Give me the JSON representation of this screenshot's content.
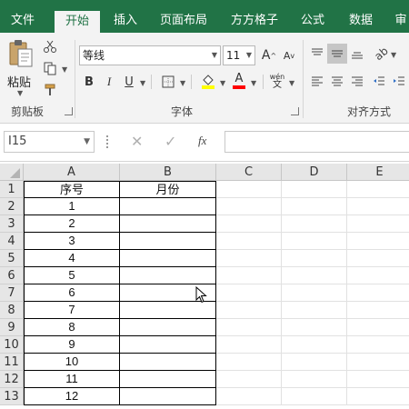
{
  "ribbon_tabs": [
    "文件",
    "开始",
    "插入",
    "页面布局",
    "方方格子",
    "公式",
    "数据",
    "审"
  ],
  "clipboard": {
    "paste_label": "粘贴",
    "group_label": "剪贴板"
  },
  "font": {
    "name": "等线",
    "size": "11",
    "group_label": "字体",
    "bold": "B",
    "italic": "I",
    "underline": "U",
    "grow": "A",
    "shrink": "A",
    "font_color_letter": "A",
    "phonetic": "wén"
  },
  "alignment": {
    "group_label": "对齐方式"
  },
  "formula_bar": {
    "name_box": "I15",
    "fx": "fx",
    "value": ""
  },
  "columns": [
    "A",
    "B",
    "C",
    "D",
    "E"
  ],
  "rows": [
    {
      "n": "1",
      "a": "序号",
      "b": "月份"
    },
    {
      "n": "2",
      "a": "1",
      "b": ""
    },
    {
      "n": "3",
      "a": "2",
      "b": ""
    },
    {
      "n": "4",
      "a": "3",
      "b": ""
    },
    {
      "n": "5",
      "a": "4",
      "b": ""
    },
    {
      "n": "6",
      "a": "5",
      "b": ""
    },
    {
      "n": "7",
      "a": "6",
      "b": ""
    },
    {
      "n": "8",
      "a": "7",
      "b": ""
    },
    {
      "n": "9",
      "a": "8",
      "b": ""
    },
    {
      "n": "10",
      "a": "9",
      "b": ""
    },
    {
      "n": "11",
      "a": "10",
      "b": ""
    },
    {
      "n": "12",
      "a": "11",
      "b": ""
    },
    {
      "n": "13",
      "a": "12",
      "b": ""
    }
  ],
  "colors": {
    "brand_green": "#217346",
    "fill_yellow": "#ffff00",
    "font_red": "#ff0000"
  }
}
